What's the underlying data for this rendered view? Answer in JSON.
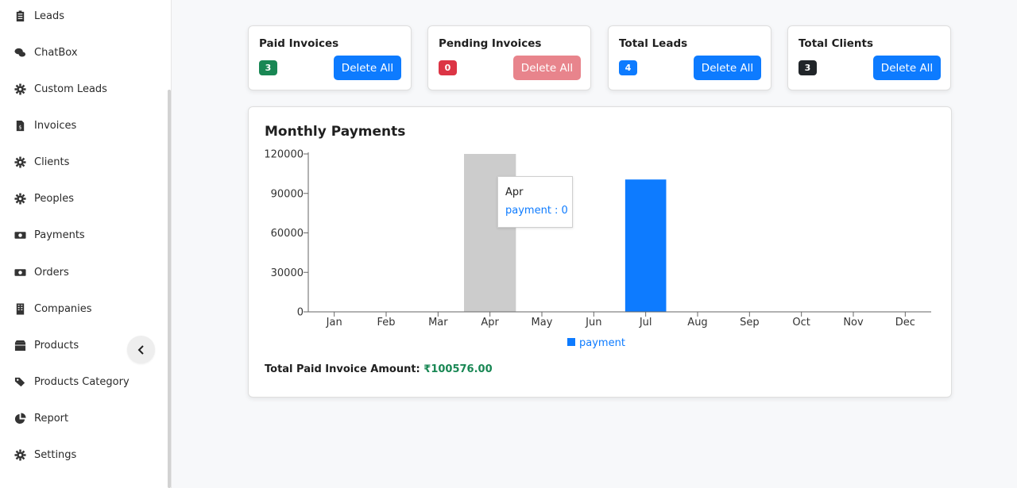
{
  "sidebar": {
    "items": [
      {
        "label": "Leads",
        "icon": "clipboard-icon"
      },
      {
        "label": "ChatBox",
        "icon": "chat-icon"
      },
      {
        "label": "Custom Leads",
        "icon": "gear-icon"
      },
      {
        "label": "Invoices",
        "icon": "invoice-icon"
      },
      {
        "label": "Clients",
        "icon": "gear-icon"
      },
      {
        "label": "Peoples",
        "icon": "gear-icon"
      },
      {
        "label": "Payments",
        "icon": "money-icon"
      },
      {
        "label": "Orders",
        "icon": "money-icon"
      },
      {
        "label": "Companies",
        "icon": "building-icon"
      },
      {
        "label": "Products",
        "icon": "box-icon"
      },
      {
        "label": "Products Category",
        "icon": "tags-icon"
      },
      {
        "label": "Report",
        "icon": "pie-chart-icon"
      },
      {
        "label": "Settings",
        "icon": "gear-icon"
      }
    ],
    "collapse_icon": "chevron-left-icon"
  },
  "cards": [
    {
      "title": "Paid Invoices",
      "count": "3",
      "badge_color": "#198754",
      "button": "Delete All",
      "disabled": false
    },
    {
      "title": "Pending Invoices",
      "count": "0",
      "badge_color": "#dc3545",
      "button": "Delete All",
      "disabled": true
    },
    {
      "title": "Total Leads",
      "count": "4",
      "badge_color": "#0d7bff",
      "button": "Delete All",
      "disabled": false
    },
    {
      "title": "Total Clients",
      "count": "3",
      "badge_color": "#212529",
      "button": "Delete All",
      "disabled": false
    }
  ],
  "chart": {
    "title": "Monthly Payments",
    "total_label": "Total Paid Invoice Amount:",
    "total_value": "₹100576.00",
    "tooltip": {
      "label": "Apr",
      "value": "payment : 0"
    }
  },
  "chart_data": {
    "type": "bar",
    "categories": [
      "Jan",
      "Feb",
      "Mar",
      "Apr",
      "May",
      "Jun",
      "Jul",
      "Aug",
      "Sep",
      "Oct",
      "Nov",
      "Dec"
    ],
    "series": [
      {
        "name": "payment",
        "color": "#0d7bff",
        "values": [
          0,
          0,
          0,
          0,
          0,
          0,
          100576,
          0,
          0,
          0,
          0,
          0
        ]
      }
    ],
    "yticks": [
      0,
      30000,
      60000,
      90000,
      120000
    ],
    "ylim": [
      0,
      120000
    ],
    "hover_category": "Apr",
    "legend_position": "bottom-center",
    "grid": false
  },
  "colors": {
    "accent": "#0d7bff",
    "success": "#198754",
    "danger": "#dc3545",
    "hover": "#cccccc"
  }
}
